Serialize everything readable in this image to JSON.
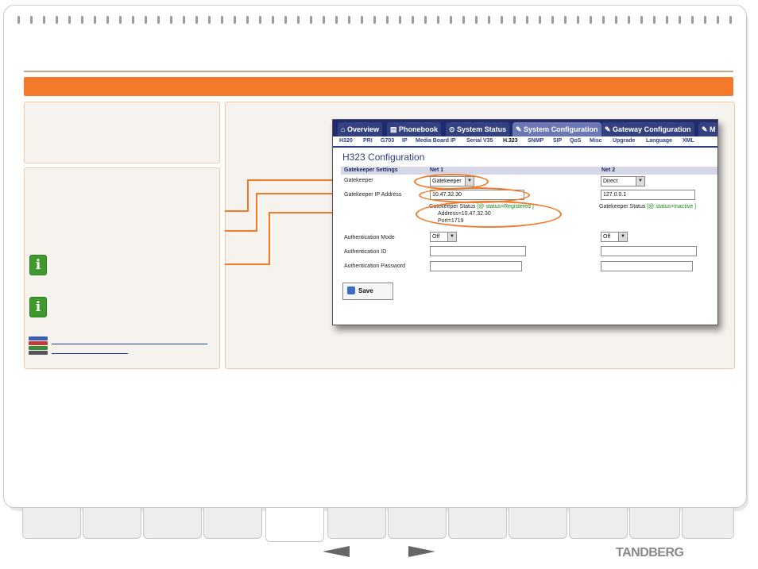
{
  "nav": {
    "tabs": [
      {
        "label": "Overview",
        "icon": "home-icon"
      },
      {
        "label": "Phonebook",
        "icon": "phonebook-icon"
      },
      {
        "label": "System Status",
        "icon": "status-icon"
      },
      {
        "label": "System Configuration",
        "icon": "wrench-icon",
        "active": true
      },
      {
        "label": "Gateway Configuration",
        "icon": "wrench-icon"
      },
      {
        "label": "M",
        "icon": "wrench-icon"
      }
    ],
    "sub_items": [
      "H320",
      "PRI",
      "G703",
      "IP",
      "Media Board IP",
      "Serial V35",
      "H.323",
      "SNMP",
      "SIP",
      "QoS",
      "Misc",
      "Upgrade",
      "Language",
      "XML"
    ]
  },
  "config": {
    "heading": "H323 Configuration",
    "section_label": "Gatekeeper Settings",
    "net1_label": "Net 1",
    "net2_label": "Net 2",
    "gatekeeper_label": "Gatekeeper",
    "net1_gatekeeper": "Gatekeeper",
    "net2_gatekeeper": "Direct",
    "ip_label": "Gatekeeper IP Address",
    "net1_ip": "10.47.32.30",
    "net2_ip": "127.0.0.1",
    "net1_status_prefix": "Gatekeeper Status",
    "net1_status_value": "[@ status=Registered ]",
    "net1_address": "Address=10.47.32.30",
    "net1_port": "Port=1719",
    "net2_status_prefix": "Gatekeeper Status",
    "net2_status_value": "[@ status=Inactive ]",
    "auth_mode_label": "Authentication Mode",
    "net1_auth_mode": "Off",
    "net2_auth_mode": "Off",
    "auth_id_label": "Authentication ID",
    "auth_password_label": "Authentication Password",
    "net1_auth_id": "",
    "net2_auth_id": "",
    "save_label": "Save"
  },
  "footer": {
    "brand": "TANDBERG"
  },
  "colors": {
    "accent": "#f37a2b",
    "nav_bg": "#1f2b6e",
    "status_green": "#1b8a1b"
  }
}
